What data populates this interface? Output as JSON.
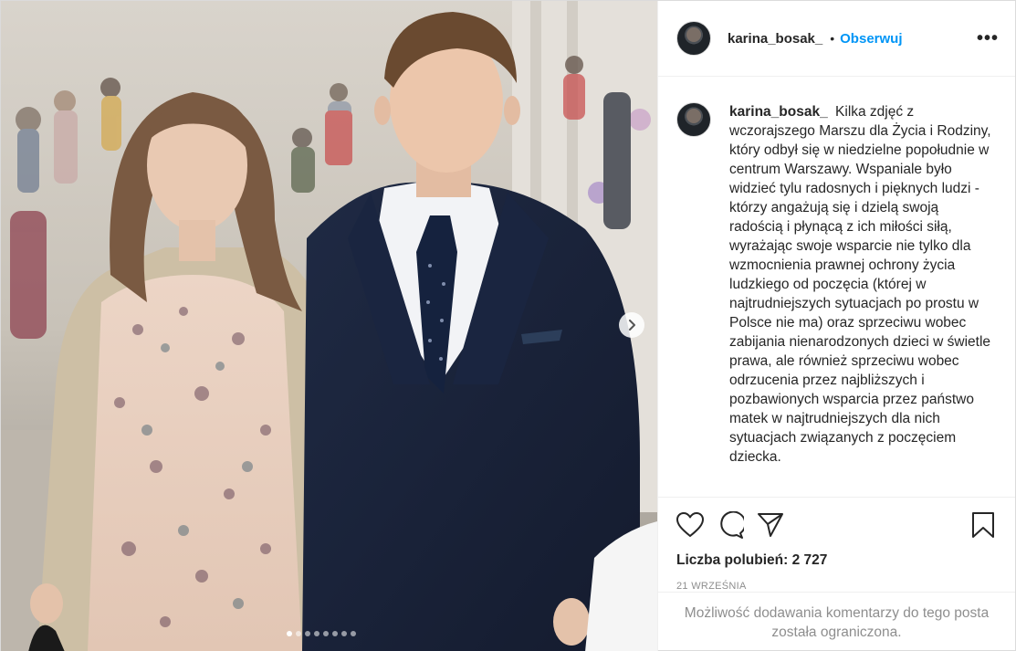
{
  "header": {
    "username": "karina_bosak_",
    "separator": "•",
    "follow_label": "Obserwuj",
    "more_label": "•••"
  },
  "caption": {
    "username": "karina_bosak_",
    "text": "Kilka zdjęć z wczorajszego Marszu dla Życia i Rodziny, który odbył się w niedzielne popołudnie w centrum Warszawy. Wspaniale było widzieć tylu radosnych i pięknych ludzi - którzy angażują się i dzielą swoją radością i płynącą z ich miłości siłą, wyrażając swoje wsparcie nie tylko dla wzmocnienia prawnej ochrony życia ludzkiego od poczęcia (której w najtrudniejszych sytuacjach po prostu w Polsce nie ma) oraz sprzeciwu wobec zabijania nienarodzonych dzieci w świetle prawa, ale również sprzeciwu wobec odrzucenia przez najbliższych i pozbawionych wsparcia przez państwo matek w najtrudniejszych dla nich sytuacjach związanych z poczęciem dziecka."
  },
  "actions": {
    "like_icon": "heart-icon",
    "comment_icon": "comment-icon",
    "share_icon": "share-icon",
    "save_icon": "bookmark-icon"
  },
  "likes_text": "Liczba polubień: 2 727",
  "date_text": "21 WRZEŚNIA",
  "comments_limited_text": "Możliwość dodawania komentarzy do tego posta została ograniczona.",
  "carousel": {
    "slide_count": 8,
    "active_index": 0,
    "next_icon": "chevron-right-icon"
  },
  "colors": {
    "link_blue": "#0095f6",
    "text": "#262626",
    "muted": "#8e8e8e",
    "border": "#efefef"
  }
}
